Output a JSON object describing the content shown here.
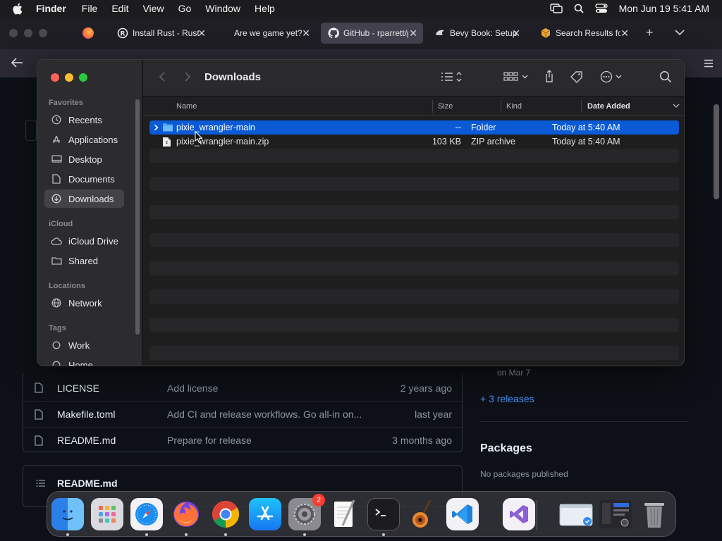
{
  "menubar": {
    "app": "Finder",
    "items": [
      "File",
      "Edit",
      "View",
      "Go",
      "Window",
      "Help"
    ],
    "clock": "Mon Jun 19  5:41 AM"
  },
  "browser": {
    "tabs": [
      {
        "label": "Install Rust - Rust",
        "icon": "rust-icon"
      },
      {
        "label": "Are we game yet?",
        "icon": "none"
      },
      {
        "label": "GitHub - rparrett/pixie",
        "icon": "github-icon",
        "active": true
      },
      {
        "label": "Bevy Book: Setup",
        "icon": "bevy-icon"
      },
      {
        "label": "Search Results for",
        "icon": "package-icon"
      }
    ],
    "new_tab": "+"
  },
  "github": {
    "files": [
      {
        "name": "LICENSE",
        "commit": "Add license",
        "when": "2 years ago"
      },
      {
        "name": "Makefile.toml",
        "commit": "Add CI and release workflows. Go all-in on...",
        "when": "last year"
      },
      {
        "name": "README.md",
        "commit": "Prepare for release",
        "when": "3 months ago"
      }
    ],
    "readme_title": "README.md",
    "released": "on Mar 7",
    "releases_link": "+ 3 releases",
    "packages_title": "Packages",
    "packages_empty": "No packages published"
  },
  "finder": {
    "title": "Downloads",
    "sidebar": {
      "favorites_label": "Favorites",
      "favorites": [
        "Recents",
        "Applications",
        "Desktop",
        "Documents",
        "Downloads"
      ],
      "icloud_label": "iCloud",
      "icloud": [
        "iCloud Drive",
        "Shared"
      ],
      "locations_label": "Locations",
      "locations": [
        "Network"
      ],
      "tags_label": "Tags",
      "tags": [
        "Work",
        "Home"
      ]
    },
    "columns": {
      "name": "Name",
      "size": "Size",
      "kind": "Kind",
      "date": "Date Added"
    },
    "rows": [
      {
        "name": "pixie_wrangler-main",
        "size": "--",
        "kind": "Folder",
        "date": "Today at 5:40 AM",
        "selected": true
      },
      {
        "name": "pixie_wrangler-main.zip",
        "size": "103 KB",
        "kind": "ZIP archive",
        "date": "Today at 5:40 AM"
      }
    ]
  },
  "dock": {
    "apps": [
      "Finder",
      "Launchpad",
      "Safari",
      "Firefox",
      "Chrome",
      "App Store",
      "System Settings",
      "TextEdit",
      "Terminal",
      "GarageBand",
      "Visual Studio Code",
      "Visual Studio",
      "Downloads",
      "Window Preview",
      "Trash"
    ],
    "settings_badge": "2"
  },
  "colors": {
    "accent": "#0a5ad6",
    "folder": "#4aa3f0"
  }
}
